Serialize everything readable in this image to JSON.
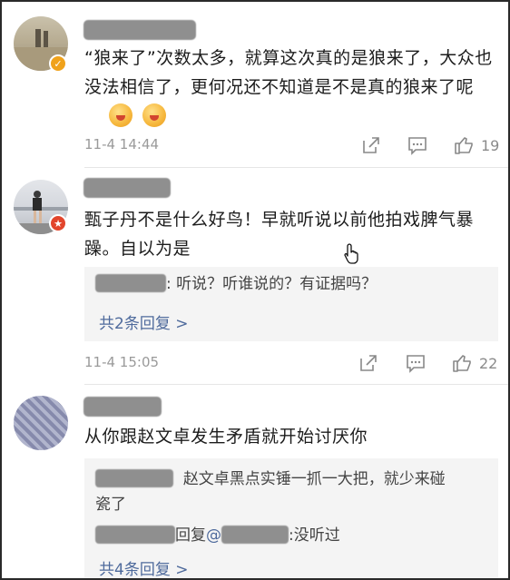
{
  "comments": [
    {
      "text": "“狼来了”次数太多，就算这次真的是狼来了，大众也没法相信了，更何况还不知道是不是真的狼来了呢",
      "time": "11-4 14:44",
      "likes": "19"
    },
    {
      "text": "甄子丹不是什么好鸟！早就听说以前他拍戏脾气暴躁。自以为是",
      "time": "11-4 15:05",
      "likes": "22",
      "replies": [
        {
          "text": ": 听说？听谁说的？有证据吗？"
        }
      ],
      "more_replies": "共2条回复 >"
    },
    {
      "text": "从你跟赵文卓发生矛盾就开始讨厌你",
      "replies": [
        {
          "text": "赵文卓黑点实锤一抓一大把，就少来碰",
          "text2": "瓷了"
        },
        {
          "reply_word": "回复",
          "at": "@",
          "text": ":没听过"
        }
      ],
      "more_replies": "共4条回复 >"
    }
  ]
}
